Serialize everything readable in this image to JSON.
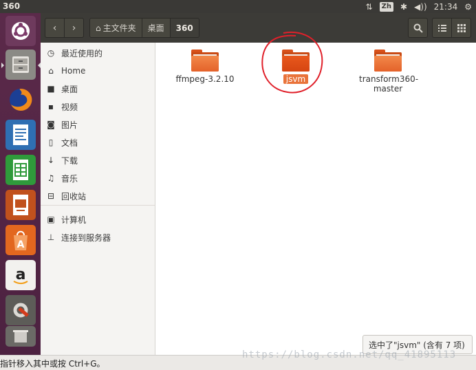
{
  "top_panel": {
    "window_title": "360",
    "keyboard_layout": "Zh",
    "clock": "21:34"
  },
  "launcher": {
    "apps": [
      "ubuntu-dash-icon",
      "files-icon",
      "firefox-icon",
      "writer-icon",
      "calc-icon",
      "impress-icon",
      "software-center-icon",
      "amazon-icon",
      "system-settings-icon",
      "trash-icon"
    ]
  },
  "header": {
    "path": [
      "主文件夹",
      "桌面",
      "360"
    ]
  },
  "sidebar": {
    "places": [
      {
        "label": "最近使用的",
        "icon": "clock-icon",
        "glyph": "◷"
      },
      {
        "label": "Home",
        "icon": "home-icon",
        "glyph": "⌂"
      },
      {
        "label": "桌面",
        "icon": "desktop-folder-icon",
        "glyph": "■"
      },
      {
        "label": "视频",
        "icon": "video-icon",
        "glyph": "▪"
      },
      {
        "label": "图片",
        "icon": "camera-icon",
        "glyph": "◙"
      },
      {
        "label": "文档",
        "icon": "document-icon",
        "glyph": "▯"
      },
      {
        "label": "下载",
        "icon": "download-icon",
        "glyph": "↓"
      },
      {
        "label": "音乐",
        "icon": "music-icon",
        "glyph": "♫"
      },
      {
        "label": "回收站",
        "icon": "trash-icon",
        "glyph": "⊟"
      }
    ],
    "devices": [
      {
        "label": "计算机",
        "icon": "computer-icon",
        "glyph": "▣"
      },
      {
        "label": "连接到服务器",
        "icon": "server-icon",
        "glyph": "⊥"
      }
    ]
  },
  "files": [
    {
      "name": "ffmpeg-3.2.10",
      "selected": false
    },
    {
      "name": "jsvm",
      "selected": true
    },
    {
      "name": "transform360-master",
      "selected": false
    }
  ],
  "status": {
    "selection": "选中了\"jsvm\" (含有 7 项)",
    "hint": "指针移入其中或按 Ctrl+G。"
  },
  "watermark": "https://blog.csdn.net/qq_41895113",
  "colors": {
    "accent": "#e9733a",
    "launcher": "#5b2a4a",
    "panel": "#3a3936",
    "annotation": "#e0202a"
  }
}
